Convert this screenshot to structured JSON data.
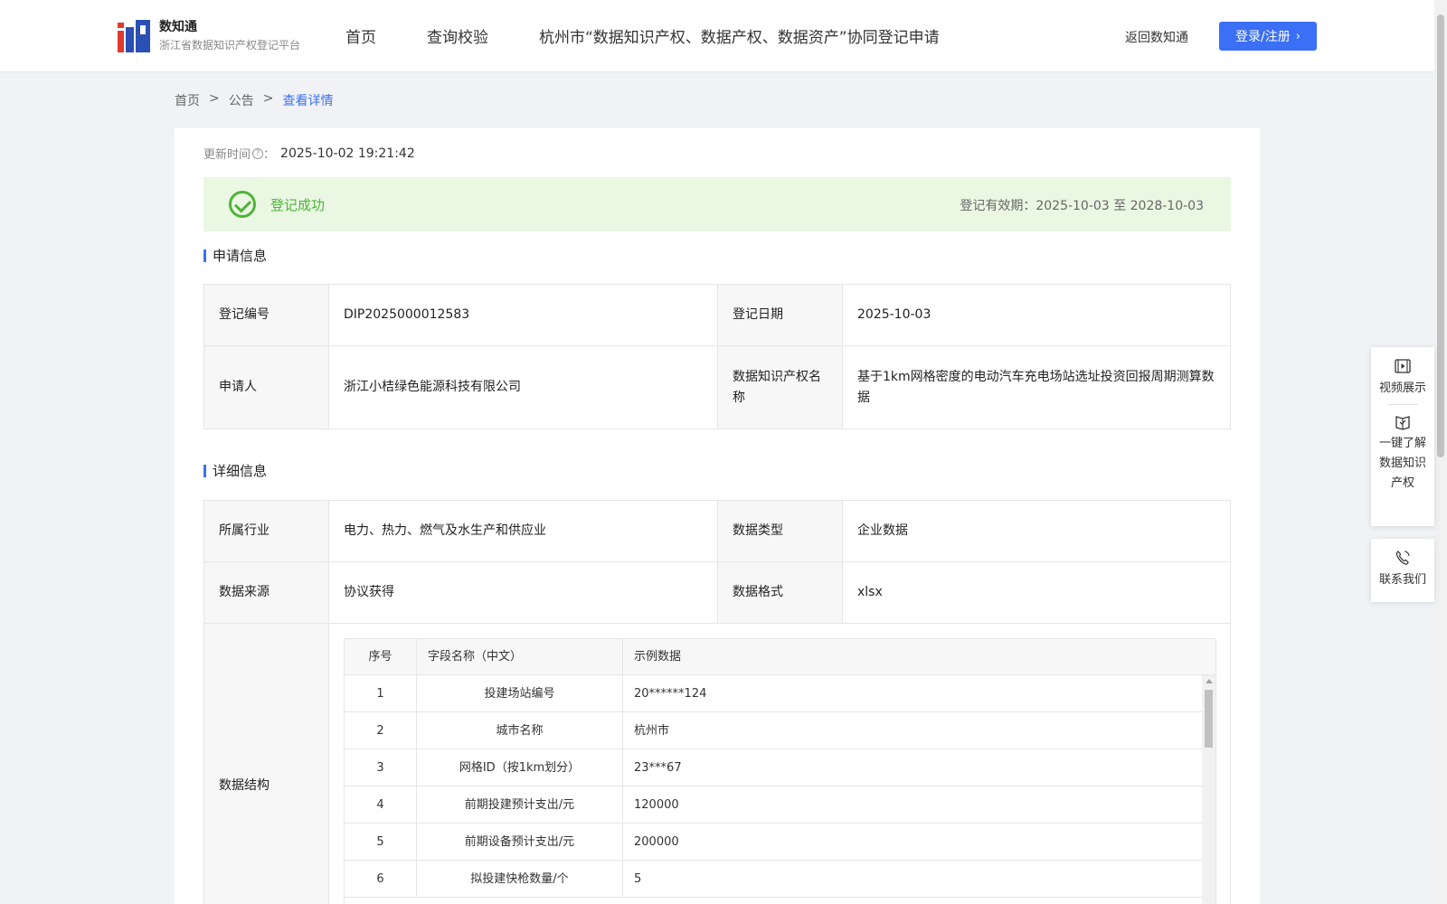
{
  "header": {
    "brand_name": "数知通",
    "brand_subtitle": "浙江省数据知识产权登记平台",
    "nav": [
      "首页",
      "查询校验",
      "杭州市“数据知识产权、数据产权、数据资产”协同登记申请"
    ],
    "back_link": "返回数知通",
    "login_label": "登录/注册",
    "accent_color": "#3b6ff5"
  },
  "breadcrumb": [
    "首页",
    ">",
    "公告",
    ">",
    "查看详情"
  ],
  "update": {
    "label": "更新时间",
    "sep": "：",
    "value": "2025-10-02 19:21:42"
  },
  "status": {
    "text": "登记成功",
    "validity_label": "登记有效期：",
    "validity_start": "2025-10-03",
    "validity_to": "至",
    "validity_end": "2028-10-03",
    "color": "#52b33a"
  },
  "application": {
    "title": "申请信息",
    "reg_no_label": "登记编号",
    "reg_no": "DIP2025000012583",
    "reg_date_label": "登记日期",
    "reg_date": "2025-10-03",
    "applicant_label": "申请人",
    "applicant": "浙江小桔绿色能源科技有限公司",
    "ip_name_label": "数据知识产权名称",
    "ip_name": "基于1km网格密度的电动汽车充电场站选址投资回报周期测算数据"
  },
  "details": {
    "title": "详细信息",
    "industry_label": "所属行业",
    "industry": "电力、热力、燃气及水生产和供应业",
    "data_type_label": "数据类型",
    "data_type": "企业数据",
    "source_label": "数据来源",
    "source": "协议获得",
    "format_label": "数据格式",
    "format": "xlsx",
    "structure_label": "数据结构",
    "structure_headers": [
      "序号",
      "字段名称（中文）",
      "示例数据"
    ],
    "structure_rows": [
      [
        "1",
        "投建场站编号",
        "20******124"
      ],
      [
        "2",
        "城市名称",
        "杭州市"
      ],
      [
        "3",
        "网格ID（按1km划分）",
        "23***67"
      ],
      [
        "4",
        "前期投建预计支出/元",
        "120000"
      ],
      [
        "5",
        "前期设备预计支出/元",
        "200000"
      ],
      [
        "6",
        "拟投建快枪数量/个",
        "5"
      ]
    ]
  },
  "side_panel": {
    "video": "视频展示",
    "learn": "一键了解数据知识产权",
    "contact": "联系我们"
  }
}
